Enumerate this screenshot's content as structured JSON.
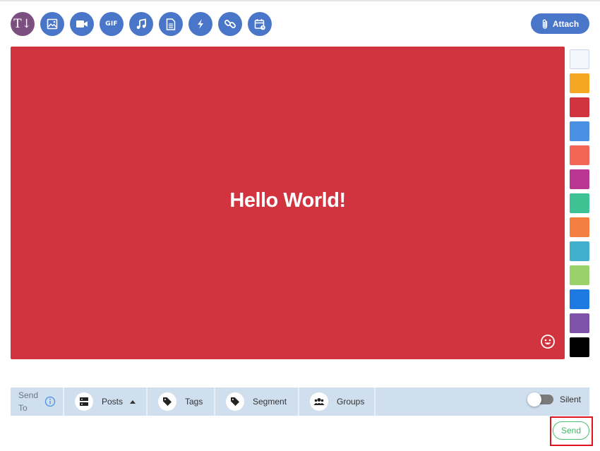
{
  "toolbar": {
    "buttons": [
      {
        "name": "text-format",
        "icon": "text-format-icon",
        "glyph": "T↓",
        "active": true
      },
      {
        "name": "image",
        "icon": "image-icon"
      },
      {
        "name": "video",
        "icon": "video-icon"
      },
      {
        "name": "gif",
        "icon": "gif-icon",
        "label": "GIF"
      },
      {
        "name": "audio",
        "icon": "music-note-icon"
      },
      {
        "name": "document",
        "icon": "document-icon"
      },
      {
        "name": "flash",
        "icon": "lightning-icon"
      },
      {
        "name": "link",
        "icon": "link-icon"
      },
      {
        "name": "event",
        "icon": "calendar-icon"
      }
    ],
    "attach_label": "Attach"
  },
  "canvas": {
    "text": "Hello World!",
    "background": "#d1343f",
    "emoji_icon": "smiley-icon"
  },
  "swatches": [
    "#f3f7fd",
    "#f5a623",
    "#d1343f",
    "#4a90e2",
    "#f06553",
    "#b93692",
    "#3fc293",
    "#f57f40",
    "#41afce",
    "#9bd16b",
    "#1c7ae2",
    "#7d52a8",
    "#000000"
  ],
  "send_to": {
    "label": "Send To",
    "segments": [
      {
        "label": "Posts",
        "icon": "posts-icon",
        "caret": true
      },
      {
        "label": "Tags",
        "icon": "tag-icon"
      },
      {
        "label": "Segment",
        "icon": "tag-icon"
      },
      {
        "label": "Groups",
        "icon": "group-icon"
      }
    ],
    "silent_label": "Silent",
    "silent_on": false
  },
  "send_label": "Send",
  "colors": {
    "accent": "#4a76c9",
    "active_tool": "#7b4f80",
    "send_green": "#43b766",
    "bar_bg": "#cfdfee",
    "highlight": "#e0141e"
  }
}
